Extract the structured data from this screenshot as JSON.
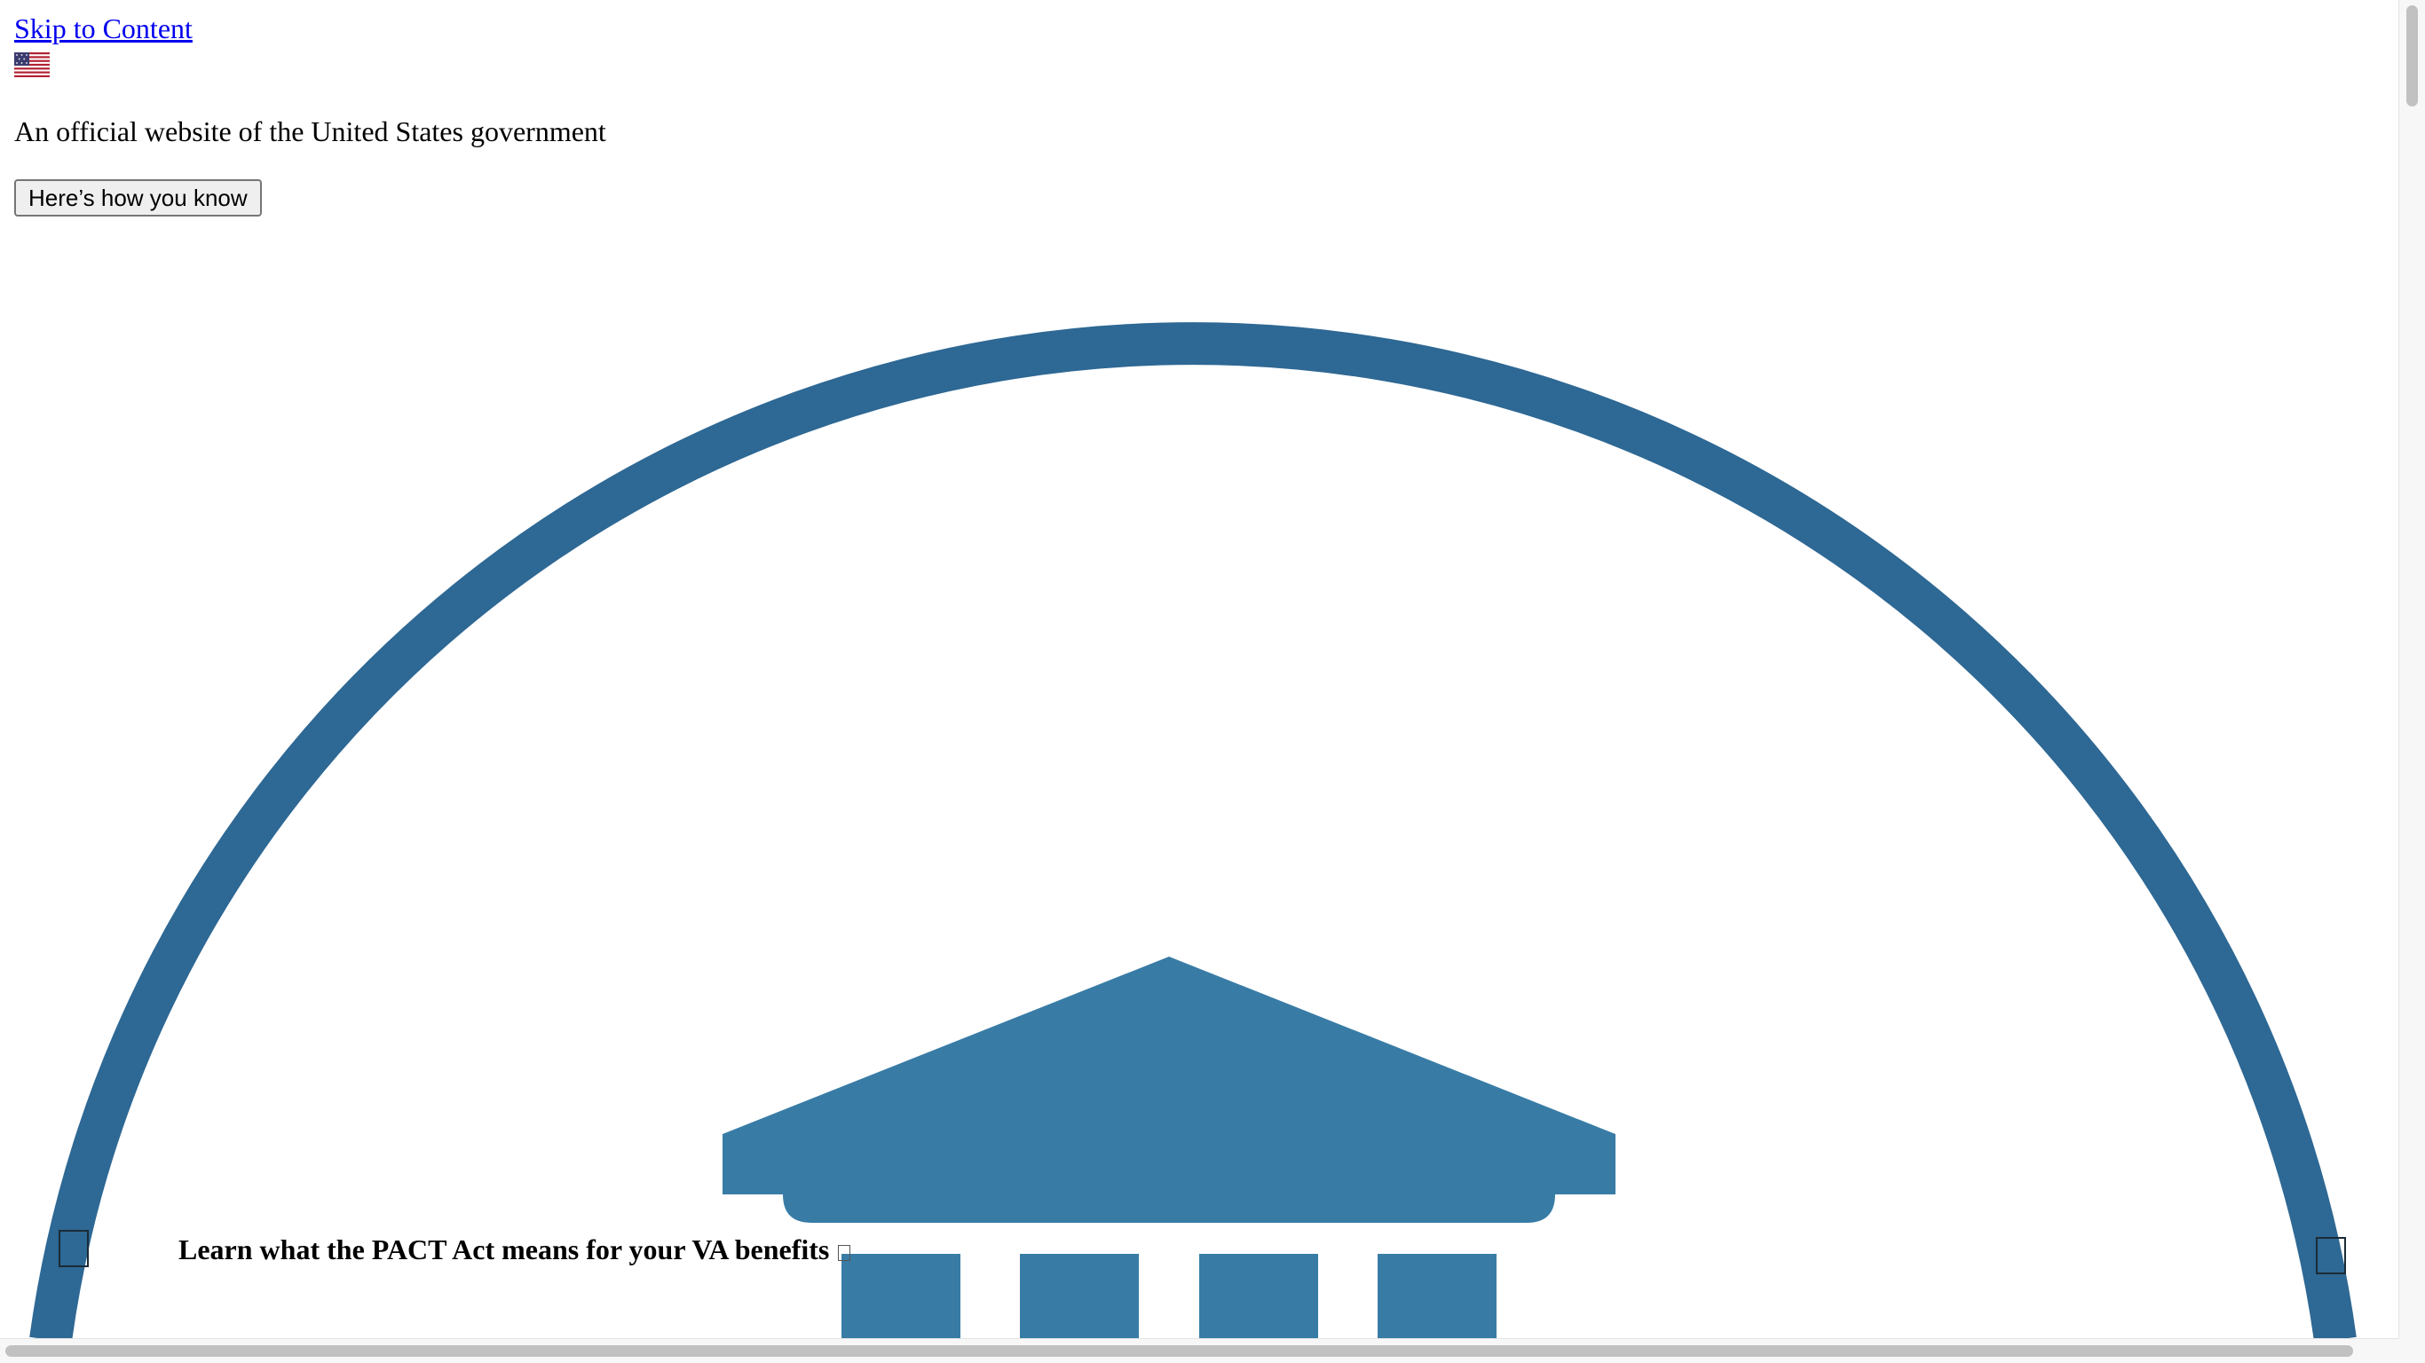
{
  "skip_link": {
    "label": "Skip to Content"
  },
  "official_banner": {
    "flag_icon": "us-flag-icon",
    "text": "An official website of the United States government",
    "button_label": "Here’s how you know"
  },
  "logo": {
    "icon": "va-building-logo-icon",
    "colors": {
      "ring": "#2e6894",
      "building": "#387ca6"
    }
  },
  "promo_banner": {
    "text": "Learn what the PACT Act means for your VA benefits",
    "icon": "external-link-icon"
  },
  "carousel": {
    "prev_icon": "previous-control-icon",
    "next_icon": "next-control-icon"
  },
  "scrollbars": {
    "vertical_icon": "vertical-scrollbar",
    "horizontal_icon": "horizontal-scrollbar"
  }
}
